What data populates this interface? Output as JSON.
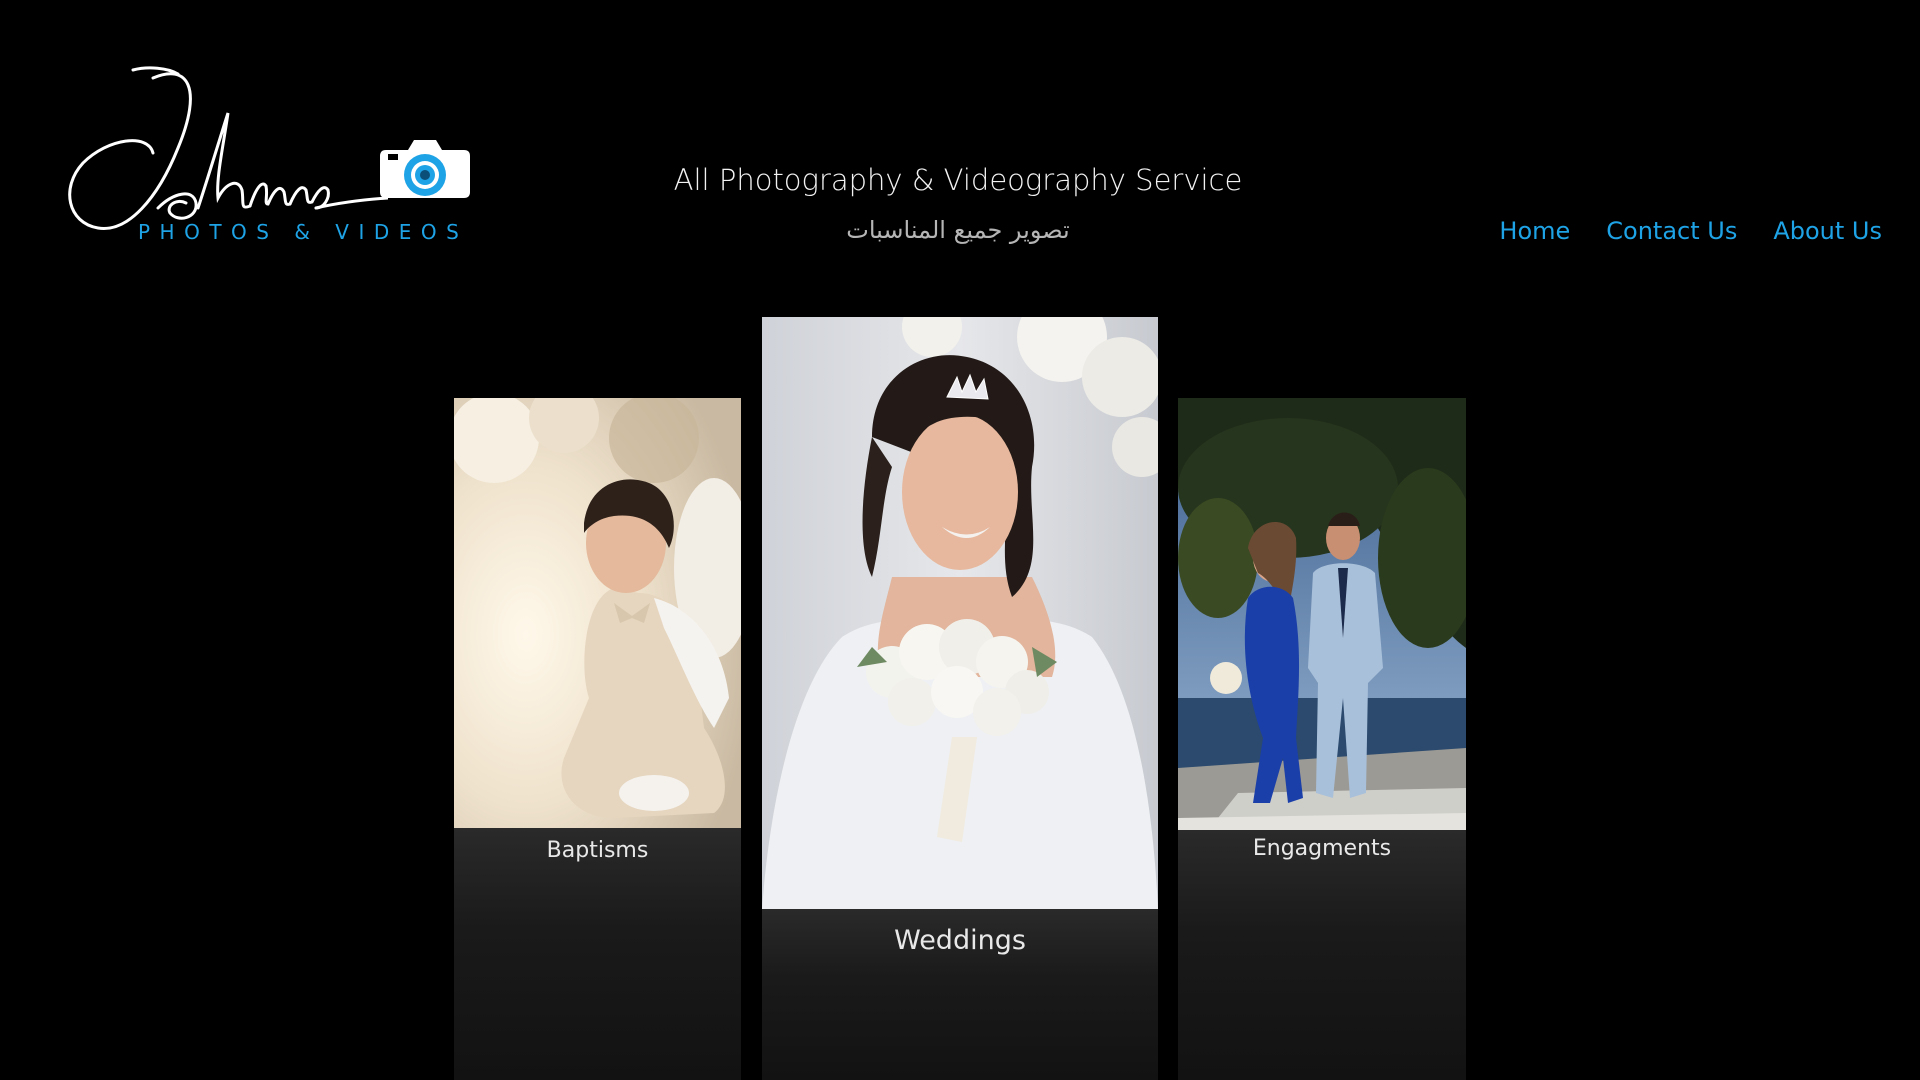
{
  "logo": {
    "script_text": "Johnny",
    "subtitle": "PHOTOS & VIDEOS",
    "icon": "camera-icon",
    "accent_color": "#1ea3e6"
  },
  "header": {
    "tagline": "All Photography & Videography Service",
    "tagline_arabic": "تصوير جميع المناسبات"
  },
  "nav": {
    "items": [
      {
        "label": "Home"
      },
      {
        "label": "Contact Us"
      },
      {
        "label": "About Us"
      }
    ]
  },
  "gallery": {
    "cards": [
      {
        "label": "Baptisms"
      },
      {
        "label": "Weddings"
      },
      {
        "label": "Engagments"
      }
    ]
  }
}
